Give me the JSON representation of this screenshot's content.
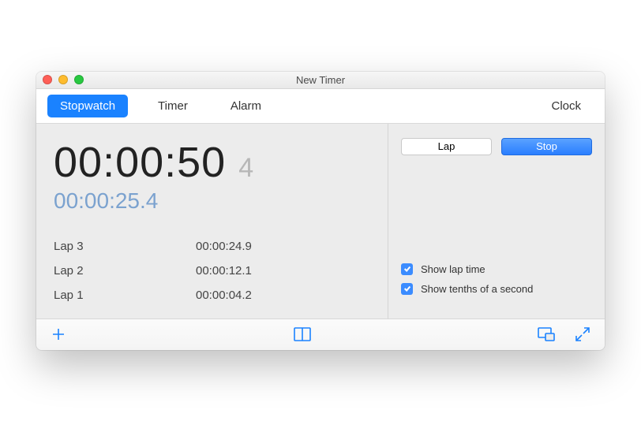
{
  "window": {
    "title": "New Timer"
  },
  "tabs": {
    "stopwatch": "Stopwatch",
    "timer": "Timer",
    "alarm": "Alarm",
    "clock": "Clock"
  },
  "stopwatch": {
    "elapsed": "00:00:50",
    "tenths": "4",
    "current_lap": "00:00:25.4",
    "laps": [
      {
        "label": "Lap 3",
        "time": "00:00:24.9"
      },
      {
        "label": "Lap 2",
        "time": "00:00:12.1"
      },
      {
        "label": "Lap 1",
        "time": "00:00:04.2"
      }
    ]
  },
  "buttons": {
    "lap": "Lap",
    "stop": "Stop"
  },
  "options": {
    "show_lap_time": {
      "label": "Show lap time",
      "checked": true
    },
    "show_tenths": {
      "label": "Show tenths of a second",
      "checked": true
    }
  }
}
